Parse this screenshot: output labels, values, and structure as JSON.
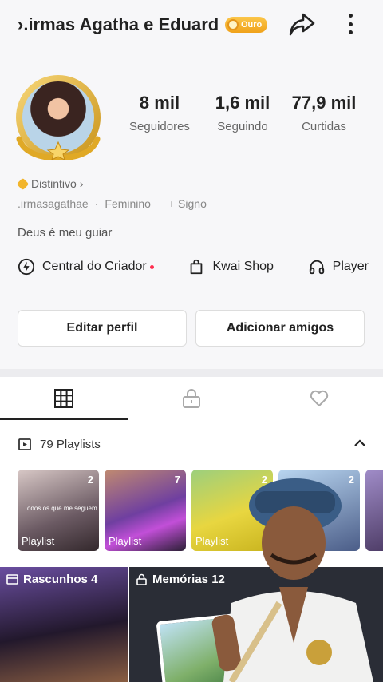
{
  "header": {
    "title": "›.irmas Agatha e Eduard",
    "badge": "Ouro"
  },
  "stats": [
    {
      "value": "8 mil",
      "label": "Seguidores"
    },
    {
      "value": "1,6 mil",
      "label": "Seguindo"
    },
    {
      "value": "77,9 mil",
      "label": "Curtidas"
    }
  ],
  "profile": {
    "distintivo": "Distintivo",
    "username": ".irmasagathae",
    "gender": "Feminino",
    "sign": "+ Signo",
    "bio": "Deus é meu guiar"
  },
  "links": {
    "creator": "Central do Criador",
    "shop": "Kwai Shop",
    "player": "Player"
  },
  "buttons": {
    "edit": "Editar perfil",
    "add": "Adicionar amigos"
  },
  "playlists": {
    "header": "79 Playlists",
    "items": [
      {
        "count": "2",
        "label": "Playlist",
        "text": "Todos os que me seguem"
      },
      {
        "count": "7",
        "label": "Playlist"
      },
      {
        "count": "2",
        "label": "Playlist"
      },
      {
        "count": "2",
        "label": ""
      }
    ]
  },
  "bottom": {
    "drafts": "Rascunhos 4",
    "memories": "Memórias 12"
  },
  "colors": {
    "accent_red": "#ff2d4f",
    "gold": "#f2b52c"
  }
}
